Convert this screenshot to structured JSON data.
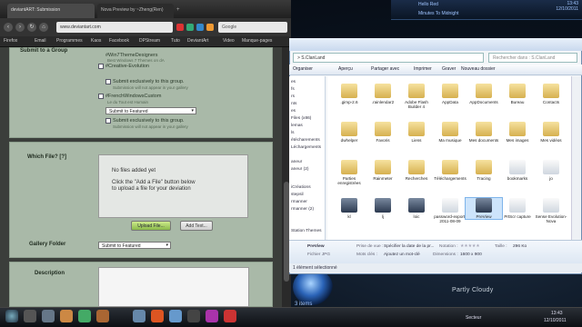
{
  "desktop": {
    "top_gadget": {
      "line1": "Hello Red",
      "line2": "Minutes To Midnight"
    },
    "clock": {
      "time": "13:43",
      "date": "12/10/2011"
    },
    "weather": "Partly Cloudy",
    "orb_label": "3 items"
  },
  "browser": {
    "tabs": [
      {
        "label": "deviantART: Submission"
      },
      {
        "label": "Nova Preview by ~Zheng(Ren)"
      }
    ],
    "url": "www.deviantart.com",
    "search_placeholder": "Google",
    "bookmarks": [
      "Firefox",
      "Email",
      "Programmes",
      "Kaos",
      "Facebook",
      "DPStream",
      "Tuto",
      "DeviantArt",
      "Video",
      "Manque-pages"
    ],
    "form": {
      "submit_group_label": "Submit to a Group",
      "groups": [
        {
          "name": "#Win7ThemeDesigners",
          "sub": "Best Windows 7 Themes on dA"
        },
        {
          "name": "#Creative-Evolution",
          "sub": ""
        }
      ],
      "submit_exclusive": "Submit exclusively to this group.",
      "submit_exclusive_note": "Submission will not appear in your gallery",
      "group3": {
        "name": "#FrenchWindowsCustom",
        "sub": "Le du Tout est Humain"
      },
      "select_featured": "Submit to Featured",
      "which_file_label": "Which File? [?]",
      "no_files": "No files added yet",
      "click_text": "Click the \"Add a File\" button below",
      "click_text2": "to upload a file for your deviation",
      "upload_btn": "Upload File...",
      "add_text_btn": "Add Text...",
      "gallery_folder_label": "Gallery Folder",
      "gallery_select": "Submit to Featured",
      "description_label": "Description"
    }
  },
  "explorer": {
    "address": "  > S.ClanLand",
    "search_placeholder": "Rechercher dans : S.ClanLand",
    "toolbar": [
      "Organiser",
      "Aperçu",
      "Partager avec",
      "Imprimer",
      "Graver",
      "Nouveau dossier"
    ],
    "nav": [
      "es",
      "fs",
      "rs",
      "nts",
      "es",
      "Files (x86)",
      "lemas",
      "ls",
      "étécharements",
      "Léchargements",
      "aneur",
      "aneur (2)",
      "iCréations",
      "stepsil",
      "rmanner",
      "rmanner (2)",
      "Station Themes"
    ],
    "files": [
      {
        "name": ".gimp-2.6",
        "icon": "folder-icon"
      },
      {
        "name": ".rainlendar2",
        "icon": "folder-icon"
      },
      {
        "name": "Adobe Flash Builder 4",
        "icon": "folder-icon"
      },
      {
        "name": "AppData",
        "icon": "folder-icon"
      },
      {
        "name": "AppDocuments",
        "icon": "folder-icon"
      },
      {
        "name": "Bureau",
        "icon": "folder-icon"
      },
      {
        "name": "Contacts",
        "icon": "folder-icon"
      },
      {
        "name": "dwhelper",
        "icon": "folder-icon"
      },
      {
        "name": "Favoris",
        "icon": "folder-icon"
      },
      {
        "name": "Liens",
        "icon": "folder-icon"
      },
      {
        "name": "Ma musique",
        "icon": "folder-icon"
      },
      {
        "name": "Mes documents",
        "icon": "folder-icon"
      },
      {
        "name": "Mes images",
        "icon": "folder-icon"
      },
      {
        "name": "Mes vidéos",
        "icon": "folder-icon"
      },
      {
        "name": "Parties enregistrées",
        "icon": "folder-icon"
      },
      {
        "name": "Rainmeter",
        "icon": "folder-icon"
      },
      {
        "name": "Recherches",
        "icon": "folder-icon"
      },
      {
        "name": "Téléchargements",
        "icon": "folder-icon"
      },
      {
        "name": "Tracing",
        "icon": "folder-icon"
      },
      {
        "name": "bookmarks",
        "icon": "file-icon"
      },
      {
        "name": "jo",
        "icon": "file-icon"
      },
      {
        "name": "kl",
        "icon": "image-icon"
      },
      {
        "name": "lj",
        "icon": "image-icon"
      },
      {
        "name": "loic",
        "icon": "image-icon"
      },
      {
        "name": "password-export-2011-08-09",
        "icon": "file-icon"
      },
      {
        "name": "PreView",
        "icon": "image-icon"
      },
      {
        "name": "PrtScr capture",
        "icon": "file-icon"
      },
      {
        "name": "Sense Evolution-Nova",
        "icon": "file-icon"
      }
    ],
    "details": {
      "name": "PreView",
      "type": "Fichier JPG",
      "taken_label": "Prise de vue :",
      "taken_value": "Spécifier la date de la pr...",
      "tags_label": "Mots clés :",
      "tags_value": "Ajoutez un mot-clé",
      "rating_label": "Notation :",
      "dims_label": "Dimensions :",
      "dims_value": "1600 x 900",
      "size_label": "Taille :",
      "size_value": "296 Ko"
    },
    "status": "1 élément sélectionné"
  },
  "taskbar": {
    "tray_label": "Secteur",
    "time": "13:43",
    "date": "12/10/2011"
  }
}
